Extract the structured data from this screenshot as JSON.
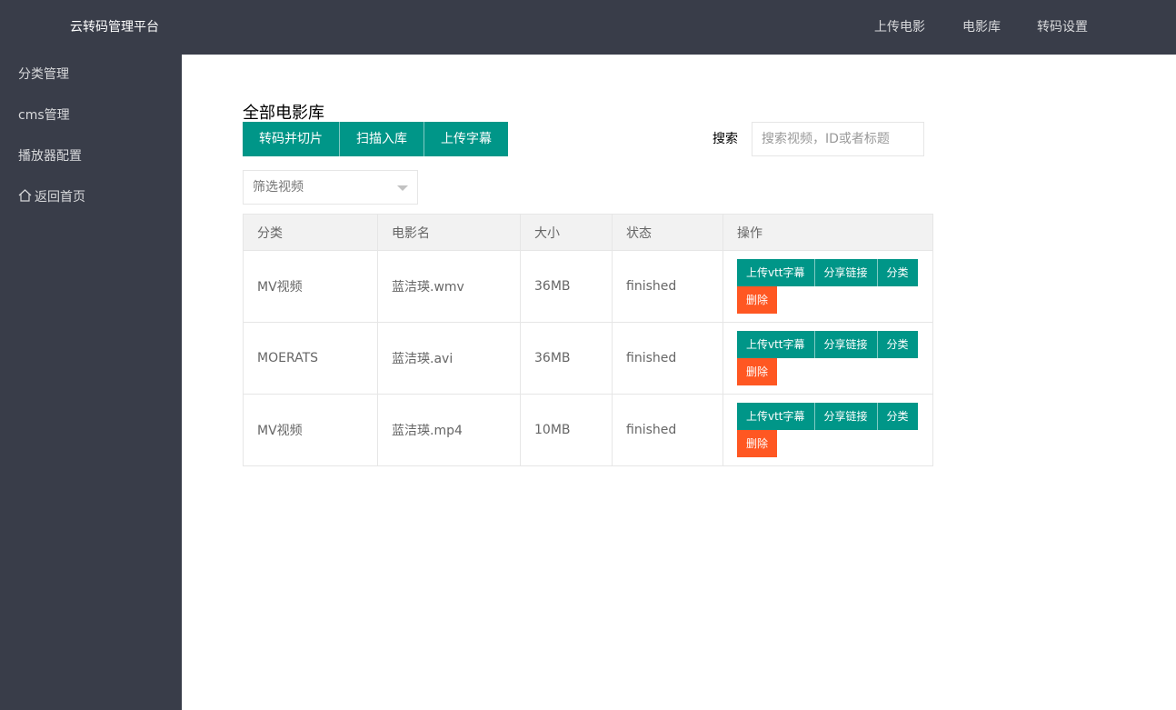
{
  "header": {
    "logo": "云转码管理平台",
    "nav": [
      "上传电影",
      "电影库",
      "转码设置"
    ]
  },
  "sidebar": {
    "items": [
      {
        "label": "分类管理"
      },
      {
        "label": "cms管理"
      },
      {
        "label": "播放器配置"
      },
      {
        "label": "返回首页",
        "icon": "home-icon"
      }
    ]
  },
  "main": {
    "title": "全部电影库",
    "buttons": [
      "转码并切片",
      "扫描入库",
      "上传字幕"
    ],
    "search_label": "搜索",
    "search_placeholder": "搜索视频，ID或者标题",
    "filter_placeholder": "筛选视频"
  },
  "table": {
    "headers": [
      "分类",
      "电影名",
      "大小",
      "状态",
      "操作"
    ],
    "rows": [
      {
        "category": "MV视频",
        "name": "蓝洁瑛.wmv",
        "size": "36MB",
        "status": "finished"
      },
      {
        "category": "MOERATS",
        "name": "蓝洁瑛.avi",
        "size": "36MB",
        "status": "finished"
      },
      {
        "category": "MV视频",
        "name": "蓝洁瑛.mp4",
        "size": "10MB",
        "status": "finished"
      }
    ],
    "actions": {
      "upload_vtt": "上传vtt字幕",
      "share": "分享链接",
      "classify": "分类",
      "delete": "删除"
    }
  },
  "colors": {
    "header_bg": "#393d49",
    "primary": "#009688",
    "danger": "#ff5722"
  }
}
